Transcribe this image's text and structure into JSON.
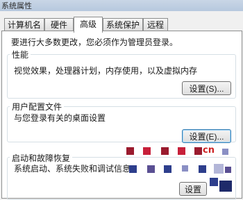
{
  "window": {
    "title": "系统属性"
  },
  "tabs": [
    {
      "label": "计算机名"
    },
    {
      "label": "硬件"
    },
    {
      "label": "高级",
      "active": true
    },
    {
      "label": "系统保护"
    },
    {
      "label": "远程"
    }
  ],
  "notice": "要进行大多数更改，您必须作为管理员登录。",
  "performance": {
    "title": "性能",
    "description": "视觉效果，处理器计划，内存使用，以及虚拟内存",
    "button": "设置(S)..."
  },
  "user_profiles": {
    "title": "用户配置文件",
    "description": "与您登录有关的桌面设置",
    "button": "设置(E)..."
  },
  "startup_recovery": {
    "title": "启动和故障恢复",
    "description": "系统启动、系统失败和调试信息",
    "button": "设置"
  },
  "watermark": {
    "text": "cn",
    "colors": [
      "#9a1b2e",
      "#c7203a",
      "#2d3e8c",
      "#5a4f93",
      "#8a8fc4",
      "#b3b6d8"
    ]
  }
}
